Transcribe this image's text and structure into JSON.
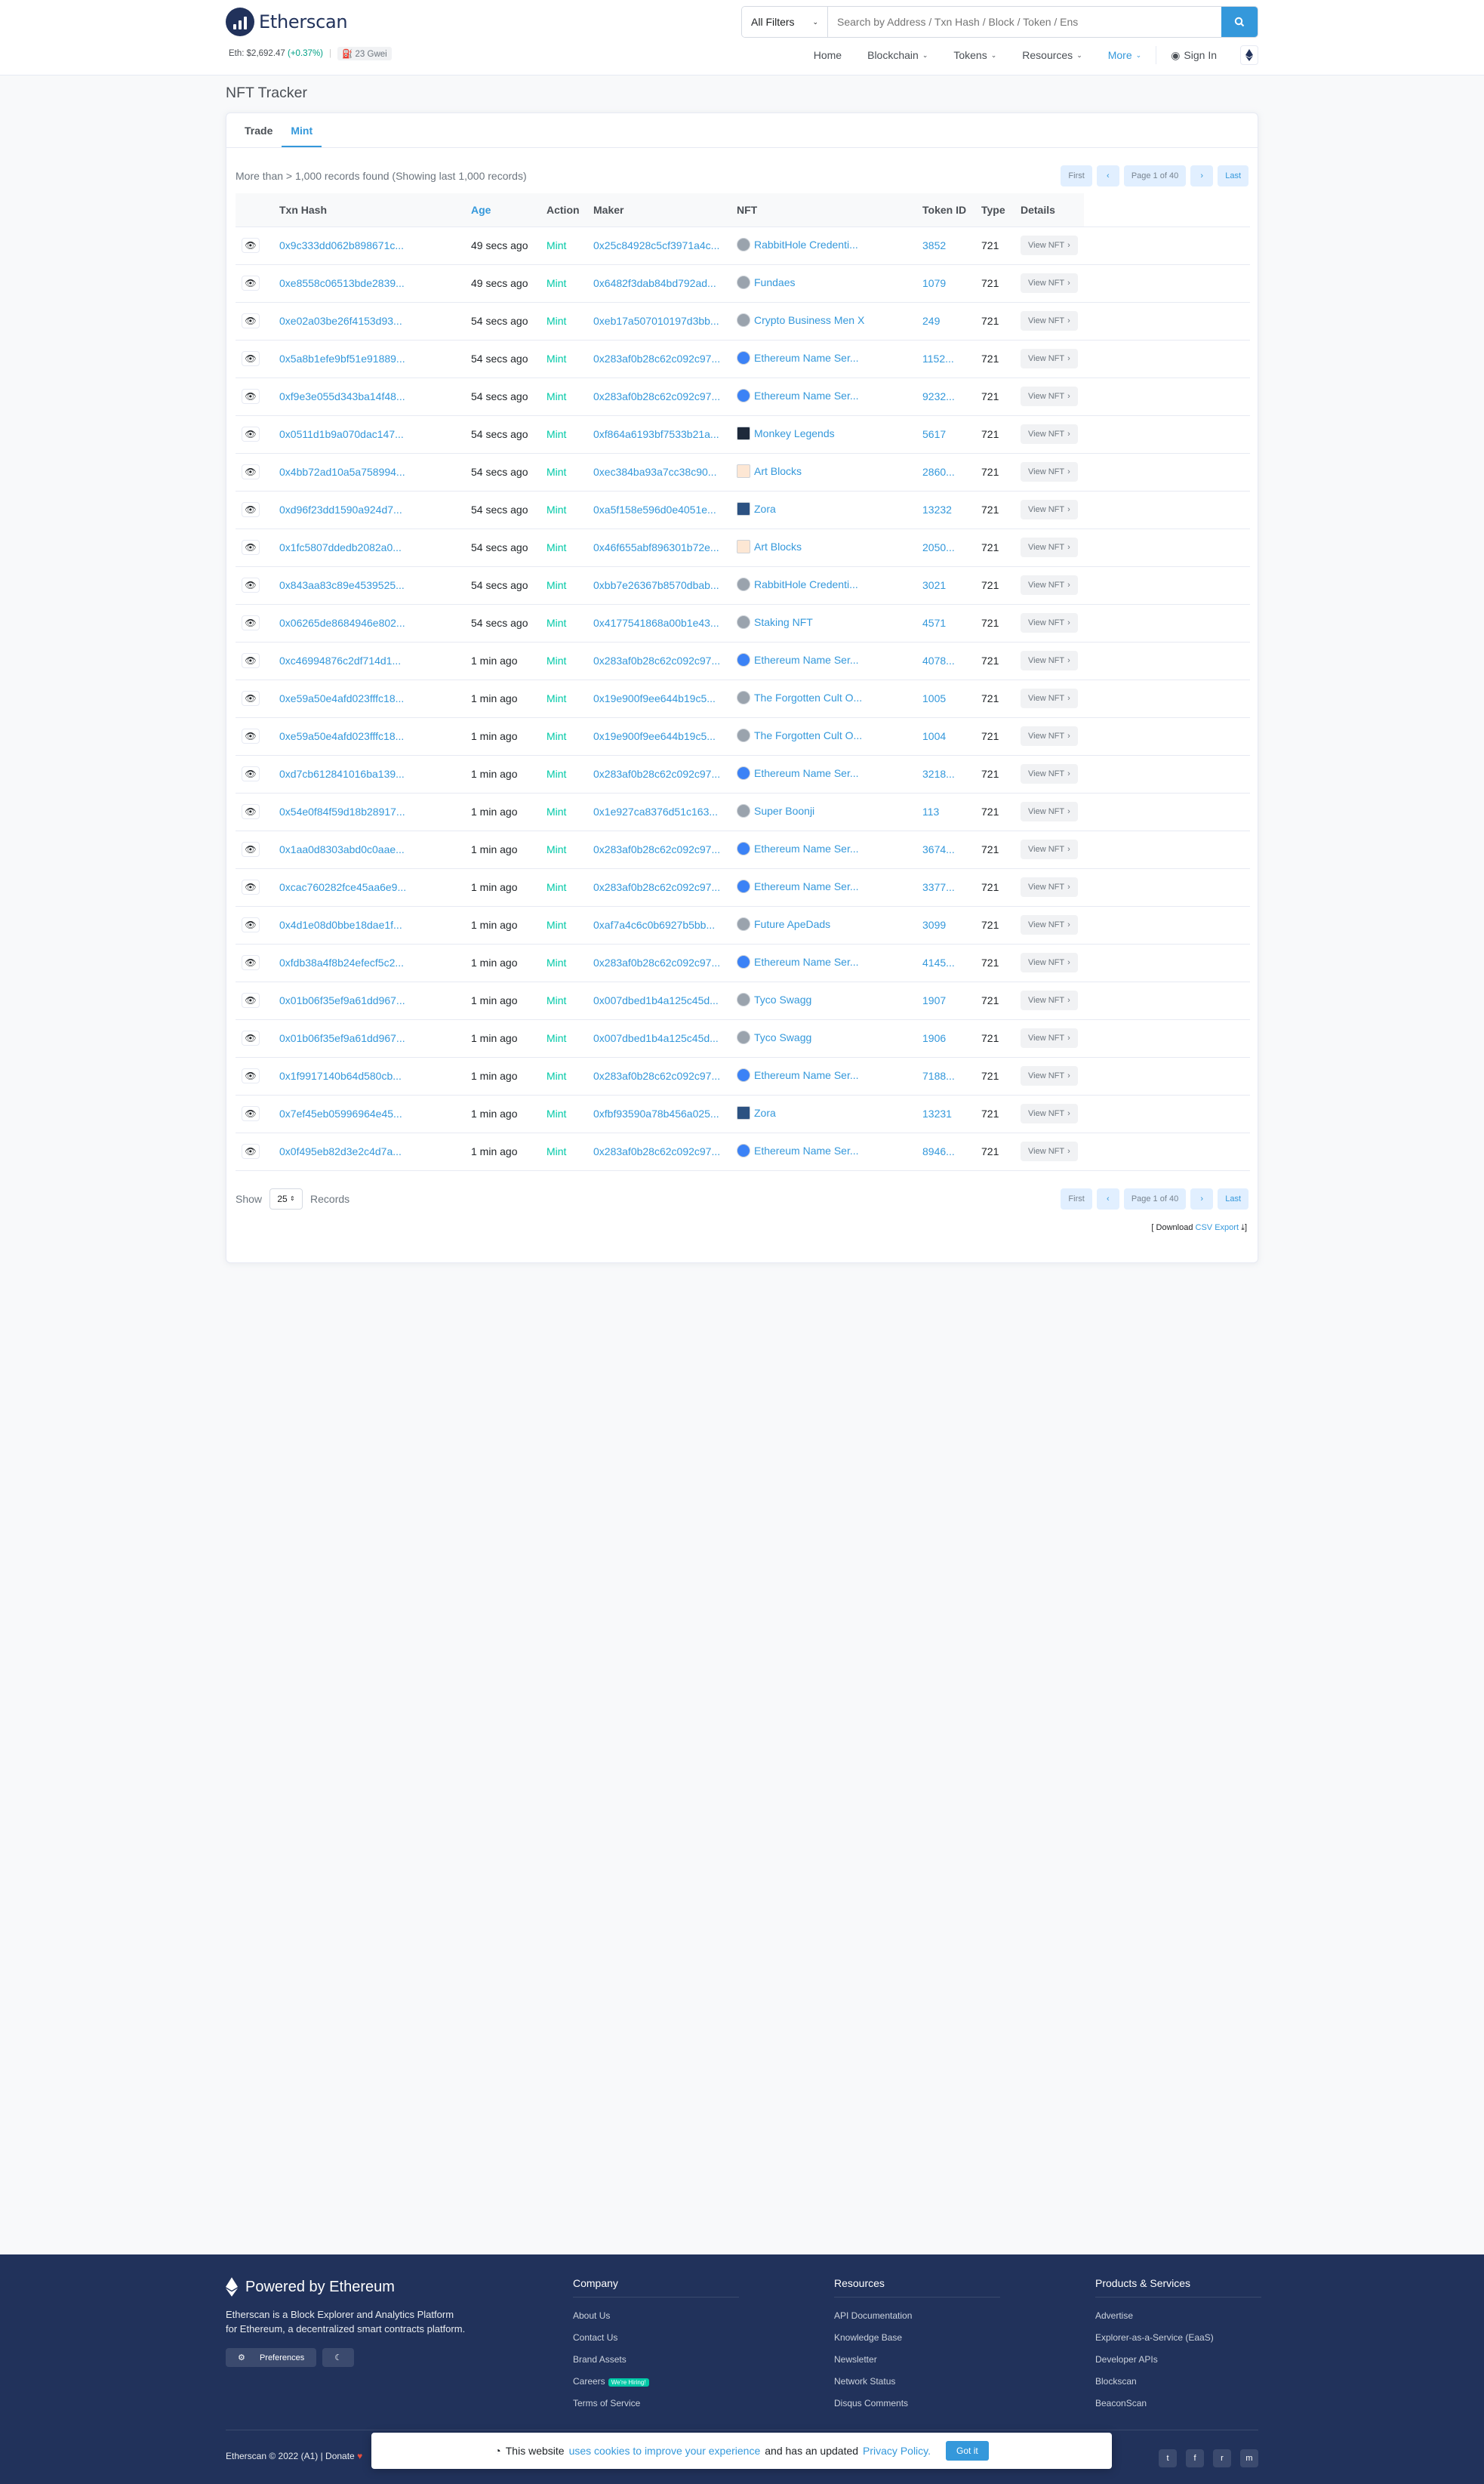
{
  "header": {
    "brand": "Etherscan",
    "eth_price_label": "Eth: $2,692.47",
    "eth_change": "(+0.37%)",
    "gas": "23 Gwei",
    "search_filter": "All Filters",
    "search_placeholder": "Search by Address / Txn Hash / Block / Token / Ens",
    "nav": [
      "Home",
      "Blockchain",
      "Tokens",
      "Resources",
      "More"
    ],
    "sign_in": "Sign In"
  },
  "page_title": "NFT Tracker",
  "tabs": [
    "Trade",
    "Mint"
  ],
  "records_found": "More than > 1,000 records found (Showing last 1,000 records)",
  "pager": {
    "first": "First",
    "page": "Page 1 of 40",
    "last": "Last"
  },
  "columns": [
    "",
    "Txn Hash",
    "Age",
    "Action",
    "Maker",
    "NFT",
    "Token ID",
    "Type",
    "Details"
  ],
  "rows": [
    {
      "hash": "0x9c333dd062b898671c...",
      "age": "49 secs ago",
      "action": "Mint",
      "maker": "0x25c84928c5cf3971a4c...",
      "icon": "round",
      "nft": "RabbitHole Credenti...",
      "token_id": "3852",
      "type": "721",
      "details": "View NFT"
    },
    {
      "hash": "0xe8558c06513bde2839...",
      "age": "49 secs ago",
      "action": "Mint",
      "maker": "0x6482f3dab84bd792ad...",
      "icon": "round",
      "nft": "Fundaes",
      "token_id": "1079",
      "type": "721",
      "details": "View NFT"
    },
    {
      "hash": "0xe02a03be26f4153d93...",
      "age": "54 secs ago",
      "action": "Mint",
      "maker": "0xeb17a507010197d3bb...",
      "icon": "round",
      "nft": "Crypto Business Men X",
      "token_id": "249",
      "type": "721",
      "details": "View NFT"
    },
    {
      "hash": "0x5a8b1efe9bf51e91889...",
      "age": "54 secs ago",
      "action": "Mint",
      "maker": "0x283af0b28c62c092c97...",
      "icon": "ens",
      "nft": "Ethereum Name Ser...",
      "token_id": "1152...",
      "type": "721",
      "details": "View NFT"
    },
    {
      "hash": "0xf9e3e055d343ba14f48...",
      "age": "54 secs ago",
      "action": "Mint",
      "maker": "0x283af0b28c62c092c97...",
      "icon": "ens",
      "nft": "Ethereum Name Ser...",
      "token_id": "9232...",
      "type": "721",
      "details": "View NFT"
    },
    {
      "hash": "0x0511d1b9a070dac147...",
      "age": "54 secs ago",
      "action": "Mint",
      "maker": "0xf864a6193bf7533b21a...",
      "icon": "sq",
      "nft": "Monkey Legends",
      "token_id": "5617",
      "type": "721",
      "details": "View NFT"
    },
    {
      "hash": "0x4bb72ad10a5a758994...",
      "age": "54 secs ago",
      "action": "Mint",
      "maker": "0xec384ba93a7cc38c90...",
      "icon": "art",
      "nft": "Art Blocks",
      "token_id": "2860...",
      "type": "721",
      "details": "View NFT"
    },
    {
      "hash": "0xd96f23dd1590a924d7...",
      "age": "54 secs ago",
      "action": "Mint",
      "maker": "0xa5f158e596d0e4051e...",
      "icon": "zora",
      "nft": "Zora",
      "token_id": "13232",
      "type": "721",
      "details": "View NFT"
    },
    {
      "hash": "0x1fc5807ddedb2082a0...",
      "age": "54 secs ago",
      "action": "Mint",
      "maker": "0x46f655abf896301b72e...",
      "icon": "art",
      "nft": "Art Blocks",
      "token_id": "2050...",
      "type": "721",
      "details": "View NFT"
    },
    {
      "hash": "0x843aa83c89e4539525...",
      "age": "54 secs ago",
      "action": "Mint",
      "maker": "0xbb7e26367b8570dbab...",
      "icon": "round",
      "nft": "RabbitHole Credenti...",
      "token_id": "3021",
      "type": "721",
      "details": "View NFT"
    },
    {
      "hash": "0x06265de8684946e802...",
      "age": "54 secs ago",
      "action": "Mint",
      "maker": "0x4177541868a00b1e43...",
      "icon": "round",
      "nft": "Staking NFT",
      "token_id": "4571",
      "type": "721",
      "details": "View NFT"
    },
    {
      "hash": "0xc46994876c2df714d1...",
      "age": "1 min ago",
      "action": "Mint",
      "maker": "0x283af0b28c62c092c97...",
      "icon": "ens",
      "nft": "Ethereum Name Ser...",
      "token_id": "4078...",
      "type": "721",
      "details": "View NFT"
    },
    {
      "hash": "0xe59a50e4afd023fffc18...",
      "age": "1 min ago",
      "action": "Mint",
      "maker": "0x19e900f9ee644b19c5...",
      "icon": "round",
      "nft": "The Forgotten Cult O...",
      "token_id": "1005",
      "type": "721",
      "details": "View NFT"
    },
    {
      "hash": "0xe59a50e4afd023fffc18...",
      "age": "1 min ago",
      "action": "Mint",
      "maker": "0x19e900f9ee644b19c5...",
      "icon": "round",
      "nft": "The Forgotten Cult O...",
      "token_id": "1004",
      "type": "721",
      "details": "View NFT"
    },
    {
      "hash": "0xd7cb612841016ba139...",
      "age": "1 min ago",
      "action": "Mint",
      "maker": "0x283af0b28c62c092c97...",
      "icon": "ens",
      "nft": "Ethereum Name Ser...",
      "token_id": "3218...",
      "type": "721",
      "details": "View NFT"
    },
    {
      "hash": "0x54e0f84f59d18b28917...",
      "age": "1 min ago",
      "action": "Mint",
      "maker": "0x1e927ca8376d51c163...",
      "icon": "round",
      "nft": "Super Boonji",
      "token_id": "113",
      "type": "721",
      "details": "View NFT"
    },
    {
      "hash": "0x1aa0d8303abd0c0aae...",
      "age": "1 min ago",
      "action": "Mint",
      "maker": "0x283af0b28c62c092c97...",
      "icon": "ens",
      "nft": "Ethereum Name Ser...",
      "token_id": "3674...",
      "type": "721",
      "details": "View NFT"
    },
    {
      "hash": "0xcac760282fce45aa6e9...",
      "age": "1 min ago",
      "action": "Mint",
      "maker": "0x283af0b28c62c092c97...",
      "icon": "ens",
      "nft": "Ethereum Name Ser...",
      "token_id": "3377...",
      "type": "721",
      "details": "View NFT"
    },
    {
      "hash": "0x4d1e08d0bbe18dae1f...",
      "age": "1 min ago",
      "action": "Mint",
      "maker": "0xaf7a4c6c0b6927b5bb...",
      "icon": "round",
      "nft": "Future ApeDads",
      "token_id": "3099",
      "type": "721",
      "details": "View NFT"
    },
    {
      "hash": "0xfdb38a4f8b24efecf5c2...",
      "age": "1 min ago",
      "action": "Mint",
      "maker": "0x283af0b28c62c092c97...",
      "icon": "ens",
      "nft": "Ethereum Name Ser...",
      "token_id": "4145...",
      "type": "721",
      "details": "View NFT"
    },
    {
      "hash": "0x01b06f35ef9a61dd967...",
      "age": "1 min ago",
      "action": "Mint",
      "maker": "0x007dbed1b4a125c45d...",
      "icon": "round",
      "nft": "Tyco Swagg",
      "token_id": "1907",
      "type": "721",
      "details": "View NFT"
    },
    {
      "hash": "0x01b06f35ef9a61dd967...",
      "age": "1 min ago",
      "action": "Mint",
      "maker": "0x007dbed1b4a125c45d...",
      "icon": "round",
      "nft": "Tyco Swagg",
      "token_id": "1906",
      "type": "721",
      "details": "View NFT"
    },
    {
      "hash": "0x1f9917140b64d580cb...",
      "age": "1 min ago",
      "action": "Mint",
      "maker": "0x283af0b28c62c092c97...",
      "icon": "ens",
      "nft": "Ethereum Name Ser...",
      "token_id": "7188...",
      "type": "721",
      "details": "View NFT"
    },
    {
      "hash": "0x7ef45eb05996964e45...",
      "age": "1 min ago",
      "action": "Mint",
      "maker": "0xfbf93590a78b456a025...",
      "icon": "zora",
      "nft": "Zora",
      "token_id": "13231",
      "type": "721",
      "details": "View NFT"
    },
    {
      "hash": "0x0f495eb82d3e2c4d7a...",
      "age": "1 min ago",
      "action": "Mint",
      "maker": "0x283af0b28c62c092c97...",
      "icon": "ens",
      "nft": "Ethereum Name Ser...",
      "token_id": "8946...",
      "type": "721",
      "details": "View NFT"
    }
  ],
  "show": {
    "label": "Show",
    "value": "25",
    "suffix": "Records"
  },
  "download": {
    "prefix": "[ Download",
    "link": "CSV Export",
    "suffix": "]"
  },
  "footer": {
    "powered": "Powered by Ethereum",
    "description": "Etherscan is a Block Explorer and Analytics Platform for Ethereum, a decentralized smart contracts platform.",
    "preferences": "Preferences",
    "columns": [
      {
        "title": "Company",
        "items": [
          "About Us",
          "Contact Us",
          "Brand Assets",
          "Careers",
          "Terms of Service"
        ]
      },
      {
        "title": "Resources",
        "items": [
          "API Documentation",
          "Knowledge Base",
          "Newsletter",
          "Network Status",
          "Disqus Comments"
        ]
      },
      {
        "title": "Products & Services",
        "items": [
          "Advertise",
          "Explorer-as-a-Service (EaaS)",
          "Developer APIs",
          "Blockscan",
          "BeaconScan"
        ]
      }
    ],
    "careers_badge": "We're Hiring!",
    "copyright": "Etherscan © 2022 (A1)  |  Donate"
  },
  "cookie": {
    "text1": "This website",
    "link1": "uses cookies to improve your experience",
    "text2": "and has an updated",
    "link2": "Privacy Policy.",
    "button": "Got it"
  }
}
